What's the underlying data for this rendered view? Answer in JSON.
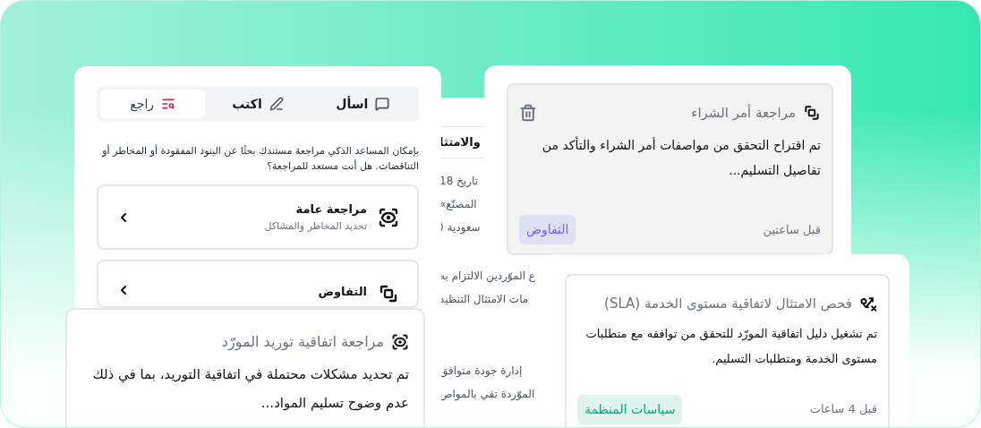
{
  "assistant_panel": {
    "tabs": [
      {
        "kind": "ask",
        "label": "اسأل",
        "selected": false
      },
      {
        "kind": "write",
        "label": "اكتب",
        "selected": false
      },
      {
        "kind": "review",
        "label": "راجع",
        "selected": true
      }
    ],
    "intro": "بإمكان المساعد الذكي مراجعة مستندك بحثًا عن البنود المفقودة أو المخاطر أو التناقضات. هل أنت مستعد للمراجعة؟",
    "options": [
      {
        "kind": "eye",
        "title": "مراجعة عامة",
        "subtitle": "تحديد المخاطر والمشاكل"
      },
      {
        "kind": "link",
        "title": "التفاوض"
      }
    ]
  },
  "document": {
    "heading": "والامتثا",
    "paragraphs": [
      [
        "تاريخ 18",
        "المصنّع»",
        "سعودية ("
      ],
      [
        "ع الموّردين الالتزام به",
        "مات الامتثال التنظيد"
      ],
      [
        "إدارة جودة متوافق",
        "الموّردة تفي بالمواص"
      ]
    ]
  },
  "purchase_review_card": {
    "kind": "link",
    "title": "مراجعة أمر الشراء",
    "body": "تم اقتراح التحقق من مواصفات أمر الشراء والتأكد من تفاصيل التسليم...",
    "time": "قبل ساعتين",
    "tag": {
      "label": "التفاوض",
      "color": "#6366f1"
    }
  },
  "sla_card": {
    "kind": "route",
    "title": "فحص الامتثال لاتفاقية مستوى الخدمة (SLA)",
    "body": "تم تشغيل دليل اتفاقية المورّد للتحقق من توافقه مع متطلبات مستوى الخدمة ومتطلبات التسليم.",
    "time": "قبل 4 ساعات",
    "tag": {
      "label": "سياسات المنظمة",
      "color": "#10a37f"
    }
  },
  "supplier_review_card": {
    "kind": "eye",
    "title": "مراجعة اتفاقية توريد المورّد",
    "body": "تم تحديد مشكلات محتملة في اتفاقية التوريد، بما في ذلك عدم وضوح تسليم المواد..."
  }
}
